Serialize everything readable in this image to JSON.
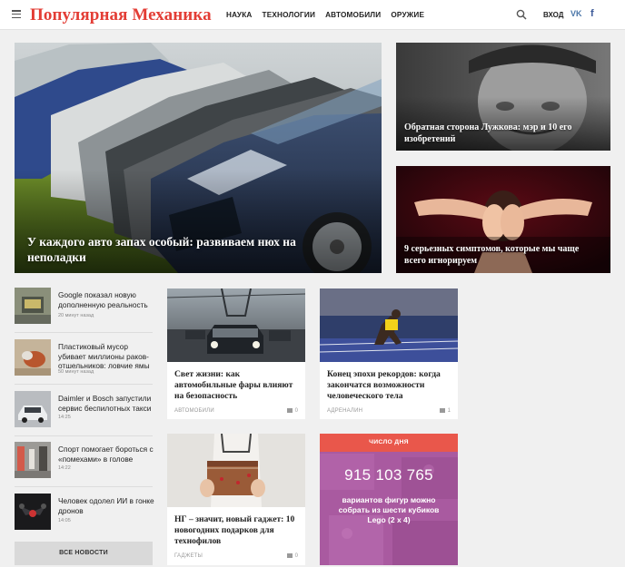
{
  "header": {
    "logo": "Популярная Механика",
    "nav": [
      "НАУКА",
      "ТЕХНОЛОГИИ",
      "АВТОМОБИЛИ",
      "ОРУЖИЕ"
    ],
    "login": "ВХОД",
    "vk": "VK",
    "fb": "f"
  },
  "hero": {
    "title": "У каждого авто запах особый: развиваем нюх на неполадки"
  },
  "side": [
    {
      "title": "Обратная сторона Лужкова: мэр и 10 его изобретений"
    },
    {
      "title": "9 серьезных симптомов, которые мы чаще всего игнорируем"
    }
  ],
  "news": [
    {
      "title": "Google показал новую дополненную реальность",
      "time": "20 минут назад"
    },
    {
      "title": "Пластиковый мусор убивает миллионы раков-отшельников: ловчие ямы",
      "time": "50 минут назад"
    },
    {
      "title": "Daimler и Bosch запустили сервис беспилотных такси",
      "time": "14:25"
    },
    {
      "title": "Спорт помогает бороться с «помехами» в голове",
      "time": "14:22"
    },
    {
      "title": "Человек одолел ИИ в гонке дронов",
      "time": "14:05"
    }
  ],
  "all_news": "ВСЕ НОВОСТИ",
  "cards": [
    {
      "title": "Свет жизни: как автомобильные фары влияют на безопасность",
      "category": "АВТОМОБИЛИ",
      "comments": "0"
    },
    {
      "title": "Конец эпохи рекордов: когда закончатся возможности человеческого тела",
      "category": "АДРЕНАЛИН",
      "comments": "1"
    },
    {
      "title": "НГ – значит, новый гаджет: 10 новогодних подарков для технофилов",
      "category": "ГАДЖЕТЫ",
      "comments": "0"
    }
  ],
  "number_of_day": {
    "label": "ЧИСЛО ДНЯ",
    "number": "915 103 765",
    "text": "вариантов фигур можно собрать из шести кубиков Lego (2 х 4)"
  },
  "colors": {
    "brand": "#e33d35",
    "vk": "#4a76a8",
    "fb": "#3b5998",
    "number_bg": "#a95aa0",
    "number_head": "#e9574b"
  }
}
